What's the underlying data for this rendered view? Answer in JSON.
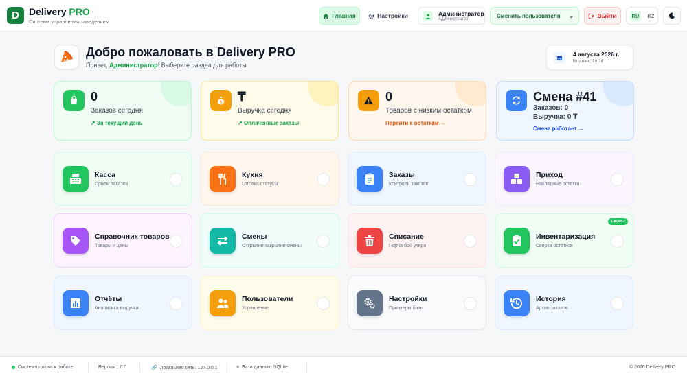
{
  "app": {
    "name_main": "Delivery",
    "name_accent": "PRO",
    "subtitle": "Система управления заведением",
    "logo_letter": "D"
  },
  "header": {
    "home_label": "Главная",
    "settings_label": "Настройки",
    "user_name": "Администратор",
    "user_role": "Администратор",
    "switch_user_label": "Сменить пользователя",
    "logout_label": "Выйти",
    "lang_ru": "RU",
    "lang_kz": "KZ"
  },
  "welcome": {
    "title": "Добро пожаловать в Delivery PRO",
    "greeting_prefix": "Привет, ",
    "greeting_name": "Администратор",
    "greeting_suffix": "! Выберите раздел для работы",
    "date": "4 августа 2026 г.",
    "weekday_time": "Вторник, 18:28"
  },
  "stats": [
    {
      "value": "0",
      "label": "Заказов сегодня",
      "link": "За текущий день",
      "color": "#16a34a",
      "icon": "shopping-bag-icon"
    },
    {
      "value": "₸",
      "label": "Выручка сегодня",
      "link": "Оплаченные заказы",
      "color": "#16a34a",
      "icon": "money-bag-icon"
    },
    {
      "value": "0",
      "label": "Товаров с низким остатком",
      "link": "Перейти к остаткам →",
      "color": "#ea580c",
      "icon": "warning-icon"
    },
    {
      "value": "Смена #41",
      "line1": "Заказов: 0",
      "line2": "Выручка: 0 ₸",
      "link": "Смена работает →",
      "color": "#1d4ed8",
      "icon": "refresh-icon"
    }
  ],
  "tiles": [
    {
      "title": "Касса",
      "subtitle": "Приём заказов",
      "icon": "cash-register-icon",
      "accent": "#22c55e"
    },
    {
      "title": "Кухня",
      "subtitle": "Готовка статусы",
      "icon": "utensils-icon",
      "accent": "#f97316"
    },
    {
      "title": "Заказы",
      "subtitle": "Контроль заказов",
      "icon": "clipboard-icon",
      "accent": "#3b82f6"
    },
    {
      "title": "Приход",
      "subtitle": "Накладные остатки",
      "icon": "boxes-icon",
      "accent": "#8b5cf6"
    },
    {
      "title": "Справочник товаров",
      "subtitle": "Товары и цены",
      "icon": "tag-icon",
      "accent": "#a855f7"
    },
    {
      "title": "Смены",
      "subtitle": "Открытие закрытие смены",
      "icon": "exchange-icon",
      "accent": "#14b8a6"
    },
    {
      "title": "Списание",
      "subtitle": "Порча бой утеря",
      "icon": "trash-icon",
      "accent": "#ef4444"
    },
    {
      "title": "Инвентаризация",
      "subtitle": "Сверка остатков",
      "icon": "clipboard-check-icon",
      "accent": "#22c55e",
      "badge": "СКОРО"
    },
    {
      "title": "Отчёты",
      "subtitle": "Аналитика выручка",
      "icon": "chart-icon",
      "accent": "#3b82f6"
    },
    {
      "title": "Пользователи",
      "subtitle": "Управление",
      "icon": "users-icon",
      "accent": "#f59e0b"
    },
    {
      "title": "Настройки",
      "subtitle": "Принтеры базы",
      "icon": "gears-icon",
      "accent": "#64748b"
    },
    {
      "title": "История",
      "subtitle": "Архив заказов",
      "icon": "history-icon",
      "accent": "#3b82f6"
    }
  ],
  "footer": {
    "status": "Система готова к работе",
    "version": "Версия 1.0.0",
    "network": "Локальная сеть: 127.0.0.1",
    "database": "База данных: SQLite",
    "copyright": "© 2026 Delivery PRO"
  }
}
